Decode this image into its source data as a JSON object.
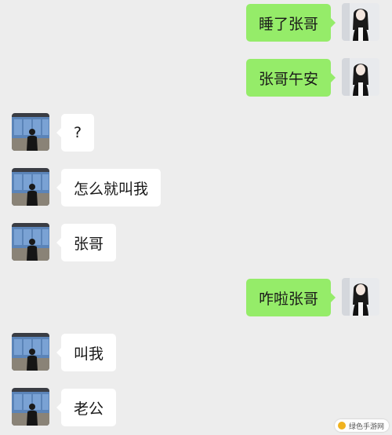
{
  "messages": [
    {
      "side": "right",
      "text": "睡了张哥"
    },
    {
      "side": "right",
      "text": "张哥午安"
    },
    {
      "side": "left",
      "text": "?"
    },
    {
      "side": "left",
      "text": "怎么就叫我"
    },
    {
      "side": "left",
      "text": "张哥"
    },
    {
      "side": "right",
      "text": "咋啦张哥"
    },
    {
      "side": "left",
      "text": "叫我"
    },
    {
      "side": "left",
      "text": "老公"
    }
  ],
  "colors": {
    "background": "#ededed",
    "incoming_bubble": "#ffffff",
    "outgoing_bubble": "#95ec69"
  },
  "watermark": {
    "text": "绿色手游网"
  }
}
